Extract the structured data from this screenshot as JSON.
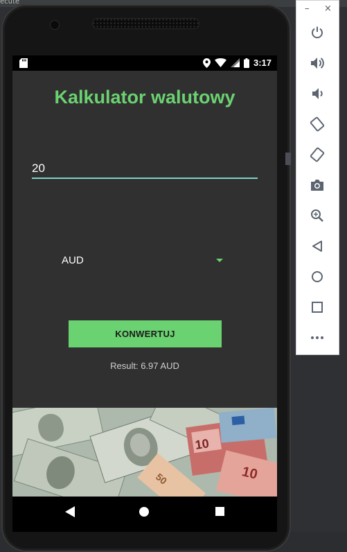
{
  "host": {
    "tab_text": "ecute"
  },
  "statusbar": {
    "time": "3:17"
  },
  "app": {
    "title": "Kalkulator walutowy",
    "amount_value": "20",
    "currency_selected": "AUD",
    "convert_label": "KONWERTUJ",
    "result_text": "Result: 6.97 AUD",
    "accent_color": "#6bd271"
  },
  "emulator_toolbar": {
    "minimize_label": "–",
    "close_label": "×",
    "buttons": [
      {
        "name": "power-icon"
      },
      {
        "name": "volume-up-icon"
      },
      {
        "name": "volume-down-icon"
      },
      {
        "name": "rotate-left-icon"
      },
      {
        "name": "rotate-right-icon"
      },
      {
        "name": "camera-icon"
      },
      {
        "name": "zoom-icon"
      },
      {
        "name": "back-icon"
      },
      {
        "name": "home-icon"
      },
      {
        "name": "overview-icon"
      },
      {
        "name": "more-icon"
      }
    ]
  }
}
